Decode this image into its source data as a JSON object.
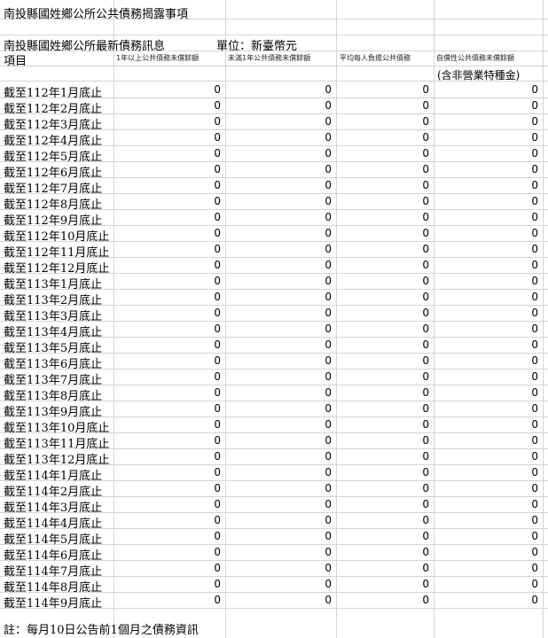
{
  "sheet": {
    "title": "南投縣國姓鄉公所公共債務揭露事項",
    "subtitle": "南投縣國姓鄉公所最新債務訊息",
    "unit": "單位：新臺幣元",
    "item_header": "項目",
    "columns": [
      "1年以上公共債務未償餘額",
      "未滿1年公共債務未償餘額",
      "平均每人負擔公共債務",
      "自償性公共債務未償餘額"
    ],
    "column4_note": "(含非營業特種金)",
    "rows": [
      {
        "label": "截至112年1月底止",
        "values": [
          "0",
          "0",
          "0",
          "0"
        ]
      },
      {
        "label": "截至112年2月底止",
        "values": [
          "0",
          "0",
          "0",
          "0"
        ]
      },
      {
        "label": "截至112年3月底止",
        "values": [
          "0",
          "0",
          "0",
          "0"
        ]
      },
      {
        "label": "截至112年4月底止",
        "values": [
          "0",
          "0",
          "0",
          "0"
        ]
      },
      {
        "label": "截至112年5月底止",
        "values": [
          "0",
          "0",
          "0",
          "0"
        ]
      },
      {
        "label": "截至112年6月底止",
        "values": [
          "0",
          "0",
          "0",
          "0"
        ]
      },
      {
        "label": "截至112年7月底止",
        "values": [
          "0",
          "0",
          "0",
          "0"
        ]
      },
      {
        "label": "截至112年8月底止",
        "values": [
          "0",
          "0",
          "0",
          "0"
        ]
      },
      {
        "label": "截至112年9月底止",
        "values": [
          "0",
          "0",
          "0",
          "0"
        ]
      },
      {
        "label": "截至112年10月底止",
        "values": [
          "0",
          "0",
          "0",
          "0"
        ]
      },
      {
        "label": "截至112年11月底止",
        "values": [
          "0",
          "0",
          "0",
          "0"
        ]
      },
      {
        "label": "截至112年12月底止",
        "values": [
          "0",
          "0",
          "0",
          "0"
        ]
      },
      {
        "label": "截至113年1月底止",
        "values": [
          "0",
          "0",
          "0",
          "0"
        ]
      },
      {
        "label": "截至113年2月底止",
        "values": [
          "0",
          "0",
          "0",
          "0"
        ]
      },
      {
        "label": "截至113年3月底止",
        "values": [
          "0",
          "0",
          "0",
          "0"
        ]
      },
      {
        "label": "截至113年4月底止",
        "values": [
          "0",
          "0",
          "0",
          "0"
        ]
      },
      {
        "label": "截至113年5月底止",
        "values": [
          "0",
          "0",
          "0",
          "0"
        ]
      },
      {
        "label": "截至113年6月底止",
        "values": [
          "0",
          "0",
          "0",
          "0"
        ]
      },
      {
        "label": "截至113年7月底止",
        "values": [
          "0",
          "0",
          "0",
          "0"
        ]
      },
      {
        "label": "截至113年8月底止",
        "values": [
          "0",
          "0",
          "0",
          "0"
        ]
      },
      {
        "label": "截至113年9月底止",
        "values": [
          "0",
          "0",
          "0",
          "0"
        ]
      },
      {
        "label": "截至113年10月底止",
        "values": [
          "0",
          "0",
          "0",
          "0"
        ]
      },
      {
        "label": "截至113年11月底止",
        "values": [
          "0",
          "0",
          "0",
          "0"
        ]
      },
      {
        "label": "截至113年12月底止",
        "values": [
          "0",
          "0",
          "0",
          "0"
        ]
      },
      {
        "label": "截至114年1月底止",
        "values": [
          "0",
          "0",
          "0",
          "0"
        ]
      },
      {
        "label": "截至114年2月底止",
        "values": [
          "0",
          "0",
          "0",
          "0"
        ]
      },
      {
        "label": "截至114年3月底止",
        "values": [
          "0",
          "0",
          "0",
          "0"
        ]
      },
      {
        "label": "截至114年4月底止",
        "values": [
          "0",
          "0",
          "0",
          "0"
        ]
      },
      {
        "label": "截至114年5月底止",
        "values": [
          "0",
          "0",
          "0",
          "0"
        ]
      },
      {
        "label": "截至114年6月底止",
        "values": [
          "0",
          "0",
          "0",
          "0"
        ]
      },
      {
        "label": "截至114年7月底止",
        "values": [
          "0",
          "0",
          "0",
          "0"
        ]
      },
      {
        "label": "截至114年8月底止",
        "values": [
          "0",
          "0",
          "0",
          "0"
        ]
      },
      {
        "label": "截至114年9月底止",
        "values": [
          "0",
          "0",
          "0",
          "0"
        ]
      }
    ],
    "note": "註：每月10日公告前1個月之債務資訊"
  }
}
